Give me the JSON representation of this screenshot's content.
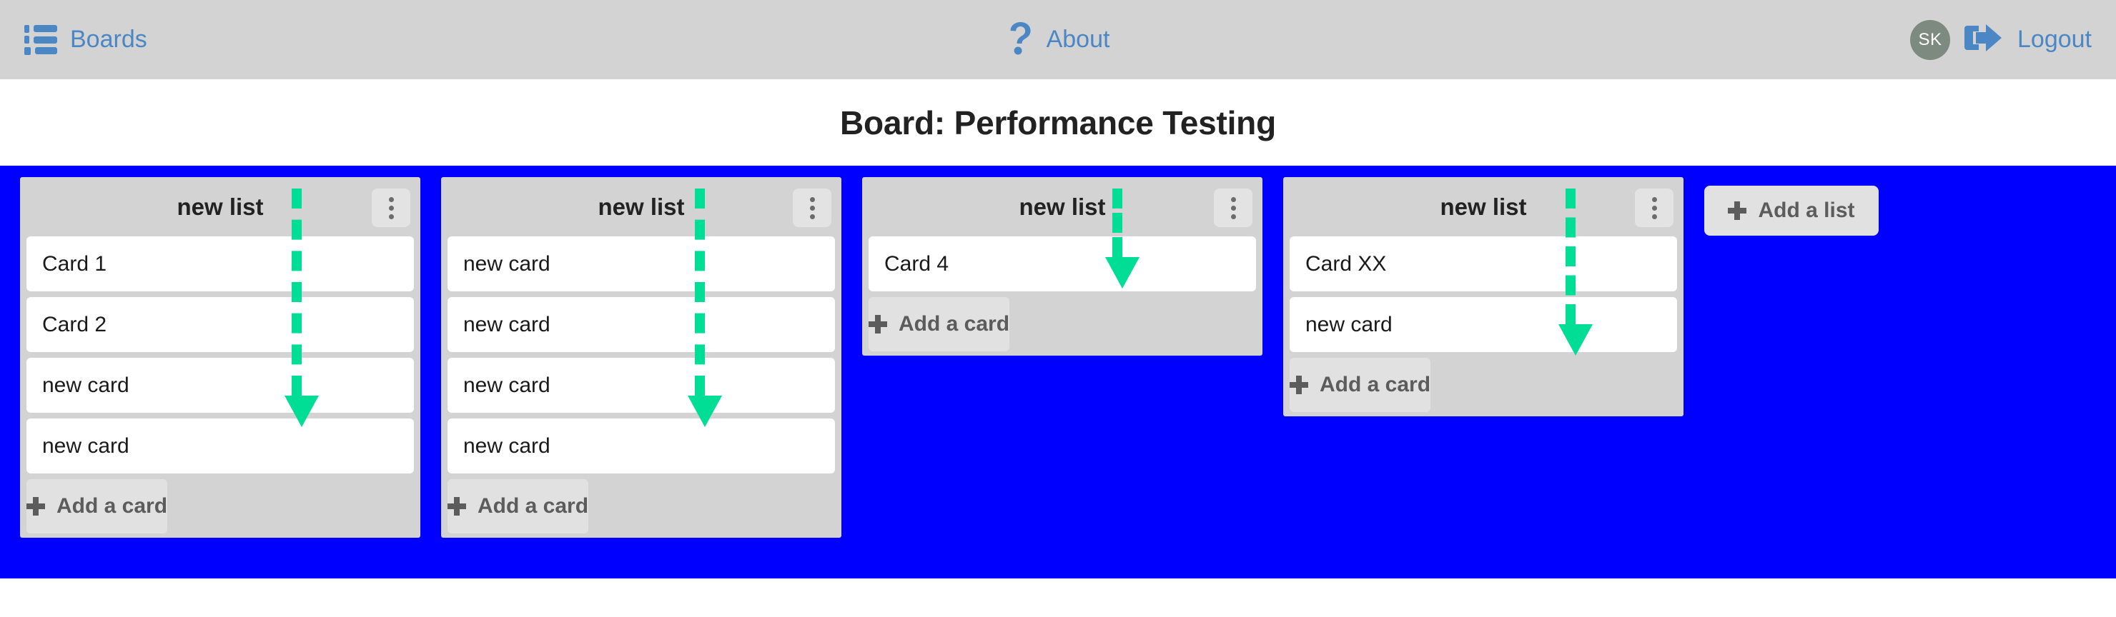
{
  "nav": {
    "boards_label": "Boards",
    "boards_icon": "list-icon",
    "about_label": "About",
    "about_icon": "question-mark-icon",
    "avatar_initials": "SK",
    "logout_label": "Logout",
    "logout_icon": "logout-arrow-icon"
  },
  "page": {
    "board_title": "Board: Performance Testing"
  },
  "board": {
    "background_color": "#0000ff",
    "add_list_label": "Add a list",
    "add_card_label": "Add a card",
    "menu_icon": "kebab-menu-icon",
    "plus_icon": "plus-icon",
    "annotation_color": "#00DE95",
    "lists": [
      {
        "title": "new list",
        "cards": [
          "Card 1",
          "Card 2",
          "new card",
          "new card"
        ],
        "add_card_label": "Add a card"
      },
      {
        "title": "new list",
        "cards": [
          "new card",
          "new card",
          "new card",
          "new card"
        ],
        "add_card_label": "Add a card"
      },
      {
        "title": "new list",
        "cards": [
          "Card 4"
        ],
        "add_card_label": "Add a card"
      },
      {
        "title": "new list",
        "cards": [
          "Card XX",
          "new card"
        ],
        "add_card_label": "Add a card"
      }
    ]
  }
}
